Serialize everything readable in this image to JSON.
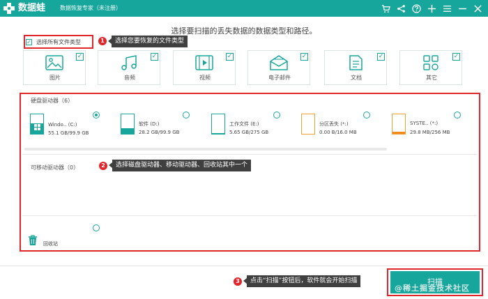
{
  "app": {
    "name": "数据蛙",
    "subtitle": "数据恢复专家（未注册）"
  },
  "heading": "选择要扫描的丢失数据的数据类型和路径。",
  "select_all": {
    "label": "选择所有文件类型",
    "checked": true
  },
  "file_types": [
    {
      "label": "图片",
      "icon": "image-icon",
      "checked": true
    },
    {
      "label": "音频",
      "icon": "music-icon",
      "checked": true
    },
    {
      "label": "视频",
      "icon": "video-icon",
      "checked": true
    },
    {
      "label": "电子邮件",
      "icon": "mail-icon",
      "checked": true
    },
    {
      "label": "文档",
      "icon": "document-icon",
      "checked": true
    },
    {
      "label": "其它",
      "icon": "other-icon",
      "checked": true
    }
  ],
  "hard_drives": {
    "label": "硬盘驱动器（6）",
    "items": [
      {
        "name": "Windo‥ (C:)",
        "size": "55.1 GB/99.9 GB",
        "used_fraction": 0.55,
        "selected": true
      },
      {
        "name": "软件 (D:)",
        "size": "28.2 GB/99.9 GB",
        "used_fraction": 0.28,
        "selected": false
      },
      {
        "name": "工作文件 (E:)",
        "size": "5.65 GB/275 GB",
        "used_fraction": 0.02,
        "selected": false
      },
      {
        "name": "分区丢失 (*:)",
        "size": "0.00  B/16.0 MB",
        "used_fraction": 0.0,
        "selected": false
      },
      {
        "name": "SYSTE‥ (*:)",
        "size": "29.8 MB/256 MB",
        "used_fraction": 0.12,
        "selected": false
      }
    ]
  },
  "removable": {
    "label": "可移动驱动器（0）"
  },
  "recycle_bin": {
    "label": "回收站"
  },
  "annotations": [
    {
      "number": "1",
      "text": "选择您要恢复的文件类型"
    },
    {
      "number": "2",
      "text": "选择磁盘驱动器、移动驱动器、回收站其中一个"
    },
    {
      "number": "3",
      "text": "点击“扫描”按钮后，软件就会开始扫描"
    }
  ],
  "scan_button": "扫描",
  "watermark": "@稀土掘金技术社区",
  "colors": {
    "accent": "#17a69b",
    "annotation": "#e0262b",
    "tooltip": "#3f3f3f",
    "warning": "#f08a1c"
  }
}
